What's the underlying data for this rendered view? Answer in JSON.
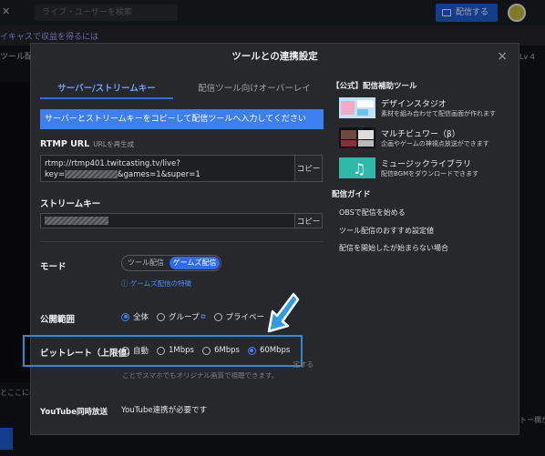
{
  "background": {
    "search_placeholder": "ライブ・ユーザーを検索",
    "go_live_label": "配信する",
    "banner_text": "イキャスで収益を得るには",
    "strip_text": "ツール配",
    "level_text": "Lv 4",
    "side_text_left": "とここに表",
    "side_text_right": "トー欄が"
  },
  "modal": {
    "title": "ツールとの連携設定",
    "close_icon": "×",
    "tabs": [
      {
        "label": "サーバー/ストリームキー",
        "active": true
      },
      {
        "label": "配信ツール向けオーバーレイ",
        "active": false
      }
    ],
    "info_text": "サーバーとストリームキーをコピーして配信ツールへ入力してください",
    "rtmp": {
      "label": "RTMP URL",
      "regenerate": "URLを再生成",
      "line1": "rtmp://rtmp401.twitcasting.tv/live?",
      "line2_prefix": "key=",
      "line2_suffix": "&games=1&super=1",
      "copy": "コピー"
    },
    "stream_key": {
      "label": "ストリームキー",
      "copy": "コピー"
    },
    "mode": {
      "label": "モード",
      "options": [
        "ツール配信",
        "ゲームズ配信"
      ],
      "selected": "ゲームズ配信",
      "help": "ゲームズ配信の特徴"
    },
    "visibility": {
      "label": "公開範囲",
      "options": [
        "全体",
        "グループ",
        "プライベー"
      ],
      "selected": "全体"
    },
    "bitrate": {
      "label": "ビットレート（上限値）",
      "options": [
        "自動",
        "1Mbps",
        "6Mbps",
        "60Mbps"
      ],
      "selected": "60Mbps",
      "note_line1": "　　　　　　　　　　　　　　　　　　　　　　　　　定する",
      "note_line2": "ことでスマホでもオリジナル画質で視聴できます。"
    },
    "youtube": {
      "label": "YouTube同時放送",
      "value": "YouTube連携が必要です"
    },
    "tools_heading": "【公式】配信補助ツール",
    "tools": [
      {
        "title": "デザインスタジオ",
        "subtitle": "素材を組み合わせて配信画面が作れます"
      },
      {
        "title": "マルチビュワー（β）",
        "subtitle": "企画やゲームの神視点放送ができます"
      },
      {
        "title": "ミュージックライブラリ",
        "subtitle": "配信BGMをダウンロードできます"
      }
    ],
    "guide_heading": "配信ガイド",
    "guides": [
      "OBSで配信を始める",
      "ツール配信のおすすめ設定値",
      "配信を開始したが始まらない場合"
    ]
  },
  "colors": {
    "accent": "#2d6cf0",
    "highlight": "#2c8ad6",
    "arrow": "#2f9be0"
  }
}
